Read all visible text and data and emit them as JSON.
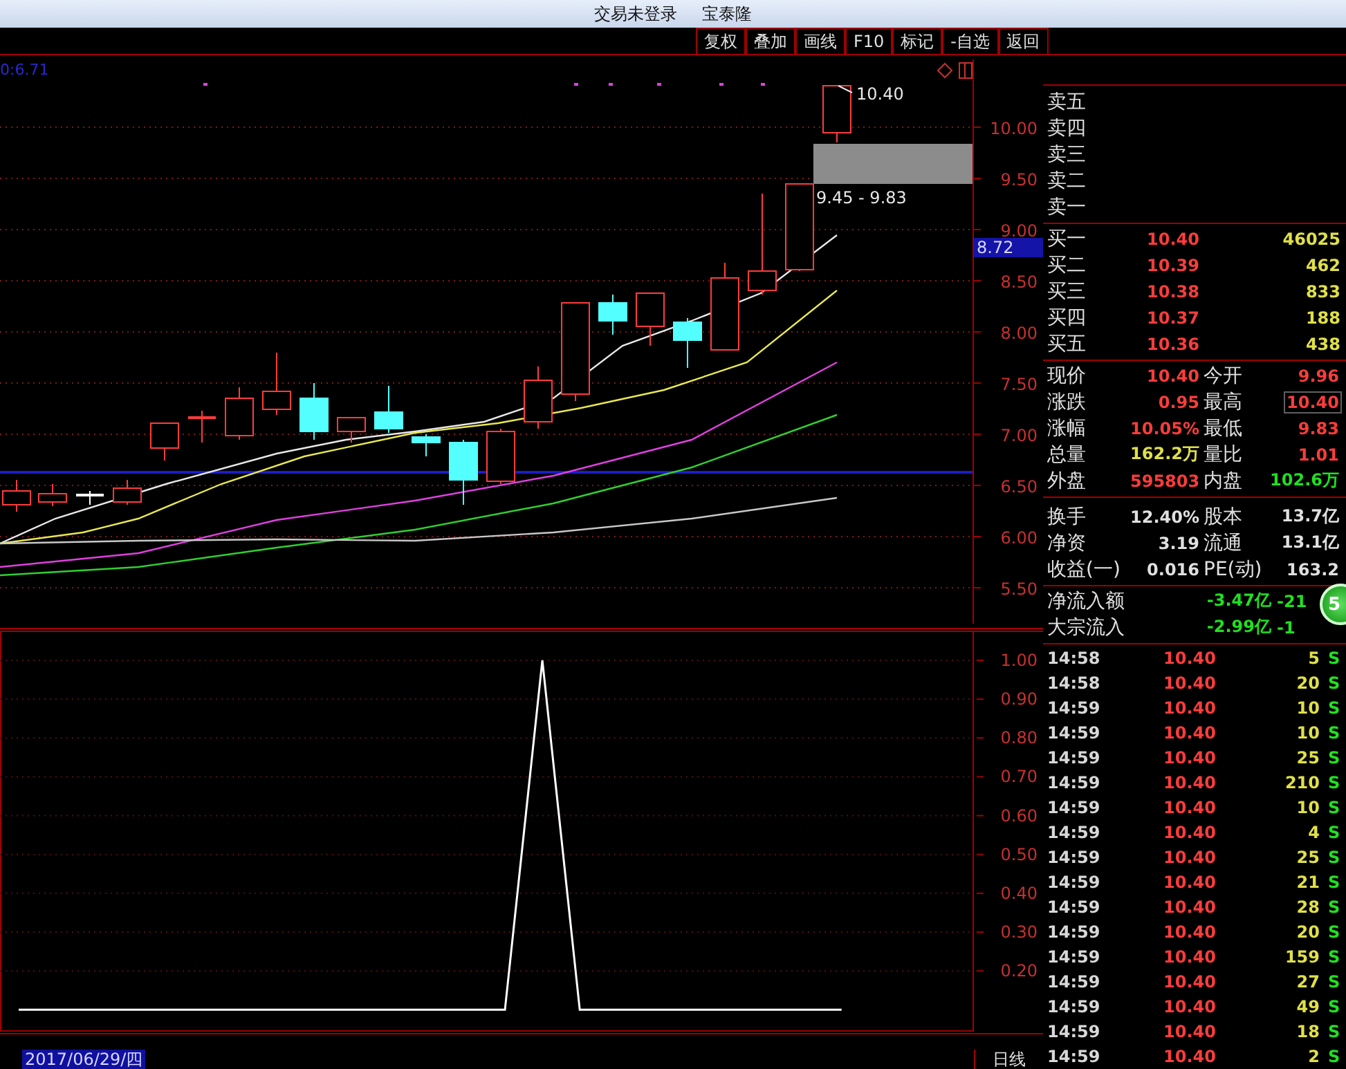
{
  "window": {
    "title": "交易未登录",
    "stock_name": "宝泰隆"
  },
  "toolbar": [
    "复权",
    "叠加",
    "画线",
    "F10",
    "标记",
    "-自选",
    "返回"
  ],
  "kline": {
    "reading": "0:6.71",
    "price_axis": [
      "10.00",
      "9.50",
      "9.00",
      "8.50",
      "8.00",
      "7.50",
      "7.00",
      "6.50",
      "6.00",
      "5.50"
    ],
    "last_price_label": "10.40",
    "range_label": "9.45 - 9.83",
    "current_marker": "8.72"
  },
  "indicator": {
    "chart_data": {
      "type": "line",
      "series": [
        {
          "color": "#ffffff",
          "values": [
            0.1,
            0.1,
            0.1,
            0.1,
            0.1,
            0.1,
            0.1,
            0.1,
            0.1,
            0.1,
            0.1,
            0.1,
            0.1,
            0.1,
            1.0,
            0.1,
            0.1,
            0.1,
            0.1,
            0.1,
            0.1,
            0.1,
            0.1,
            null,
            null,
            null
          ]
        }
      ],
      "ylim": [
        0.04,
        1.08
      ],
      "grid": true,
      "yticks": [
        {
          "value": 1.0,
          "label": "1.00"
        },
        {
          "value": 0.9,
          "label": "0.90"
        },
        {
          "value": 0.8,
          "label": "0.80"
        },
        {
          "value": 0.7,
          "label": "0.70"
        },
        {
          "value": 0.6,
          "label": "0.60"
        },
        {
          "value": 0.5,
          "label": "0.50"
        },
        {
          "value": 0.4,
          "label": "0.40"
        },
        {
          "value": 0.3,
          "label": "0.30"
        },
        {
          "value": 0.2,
          "label": "0.20"
        }
      ]
    }
  },
  "date_label": "2017/06/29/四",
  "period_label": "日线",
  "asks": [
    "卖五",
    "卖四",
    "卖三",
    "卖二",
    "卖一"
  ],
  "bids": [
    {
      "label": "买一",
      "price": "10.40",
      "volume": "46025"
    },
    {
      "label": "买二",
      "price": "10.39",
      "volume": "462"
    },
    {
      "label": "买三",
      "price": "10.38",
      "volume": "833"
    },
    {
      "label": "买四",
      "price": "10.37",
      "volume": "188"
    },
    {
      "label": "买五",
      "price": "10.36",
      "volume": "438"
    }
  ],
  "stats": [
    {
      "left": {
        "label": "现价",
        "value": "10.40",
        "color": "#ff3c3c"
      },
      "right": {
        "label": "今开",
        "value": "9.96",
        "color": "#ff3c3c",
        "boxed": false
      }
    },
    {
      "left": {
        "label": "涨跌",
        "value": "0.95",
        "color": "#ff3c3c"
      },
      "right": {
        "label": "最高",
        "value": "10.40",
        "color": "#ff3c3c",
        "boxed": true
      }
    },
    {
      "left": {
        "label": "涨幅",
        "value": "10.05%",
        "color": "#ff3c3c"
      },
      "right": {
        "label": "最低",
        "value": "9.83",
        "color": "#ff3c3c",
        "boxed": false
      }
    },
    {
      "left": {
        "label": "总量",
        "value": "162.2万",
        "color": "#e0e048"
      },
      "right": {
        "label": "量比",
        "value": "1.01",
        "color": "#ff3c3c",
        "boxed": false
      }
    },
    {
      "left": {
        "label": "外盘",
        "value": "595803",
        "color": "#ff3c3c"
      },
      "right": {
        "label": "内盘",
        "value": "102.6万",
        "color": "#20e020",
        "boxed": false
      }
    }
  ],
  "fundamentals": [
    {
      "label": "换手",
      "value": "12.40%",
      "label2": "股本",
      "value2": "13.7亿"
    },
    {
      "label": "净资",
      "value": "3.19",
      "label2": "流通",
      "value2": "13.1亿"
    },
    {
      "label": "收益(一)",
      "value": "0.016",
      "label2": "PE(动)",
      "value2": "163.2"
    }
  ],
  "flows": [
    {
      "label": "净流入额",
      "value": "-3.47亿",
      "value2": "-21"
    },
    {
      "label": "大宗流入",
      "value": "-2.99亿",
      "value2": "-1"
    }
  ],
  "badge": "5",
  "ticks": [
    {
      "time": "14:58",
      "price": "10.40",
      "volume": "5",
      "side": "S"
    },
    {
      "time": "14:58",
      "price": "10.40",
      "volume": "20",
      "side": "S"
    },
    {
      "time": "14:59",
      "price": "10.40",
      "volume": "10",
      "side": "S"
    },
    {
      "time": "14:59",
      "price": "10.40",
      "volume": "10",
      "side": "S"
    },
    {
      "time": "14:59",
      "price": "10.40",
      "volume": "25",
      "side": "S"
    },
    {
      "time": "14:59",
      "price": "10.40",
      "volume": "210",
      "side": "S"
    },
    {
      "time": "14:59",
      "price": "10.40",
      "volume": "10",
      "side": "S"
    },
    {
      "time": "14:59",
      "price": "10.40",
      "volume": "4",
      "side": "S"
    },
    {
      "time": "14:59",
      "price": "10.40",
      "volume": "25",
      "side": "S"
    },
    {
      "time": "14:59",
      "price": "10.40",
      "volume": "21",
      "side": "S"
    },
    {
      "time": "14:59",
      "price": "10.40",
      "volume": "28",
      "side": "S"
    },
    {
      "time": "14:59",
      "price": "10.40",
      "volume": "20",
      "side": "S"
    },
    {
      "time": "14:59",
      "price": "10.40",
      "volume": "159",
      "side": "S"
    },
    {
      "time": "14:59",
      "price": "10.40",
      "volume": "27",
      "side": "S"
    },
    {
      "time": "14:59",
      "price": "10.40",
      "volume": "49",
      "side": "S"
    },
    {
      "time": "14:59",
      "price": "10.40",
      "volume": "18",
      "side": "S"
    },
    {
      "time": "14:59",
      "price": "10.40",
      "volume": "2",
      "side": "S"
    }
  ]
}
